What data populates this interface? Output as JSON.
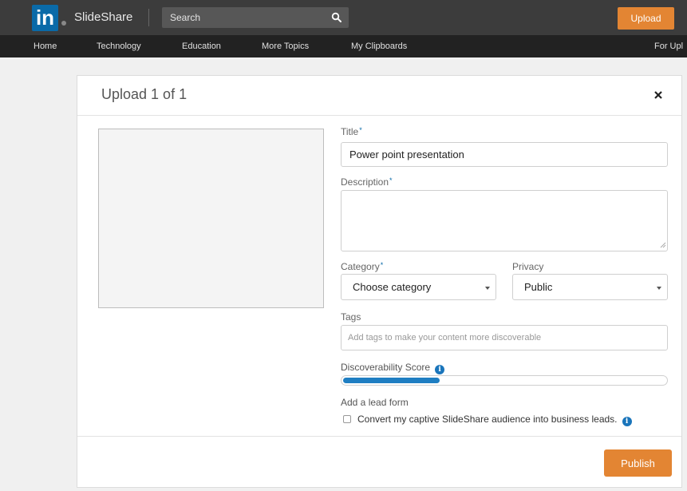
{
  "header": {
    "logo_text": "in",
    "brand": "SlideShare",
    "search_placeholder": "Search",
    "upload_label": "Upload"
  },
  "nav": {
    "items": [
      "Home",
      "Technology",
      "Education",
      "More Topics",
      "My Clipboards",
      "For Upl"
    ]
  },
  "modal": {
    "title": "Upload 1 of 1",
    "title_label": "Title",
    "title_value": "Power point presentation",
    "description_label": "Description",
    "description_value": "",
    "required_marker": "*",
    "category_label": "Category",
    "category_value": "Choose category",
    "privacy_label": "Privacy",
    "privacy_value": "Public",
    "tags_label": "Tags",
    "tags_placeholder": "Add tags to make your content more discoverable",
    "score_label": "Discoverability Score",
    "score_fraction": 0.3,
    "lead_label": "Add a lead form",
    "lead_checkbox_label": "Convert my captive SlideShare audience into business leads.",
    "lead_checked": false,
    "publish_label": "Publish"
  },
  "colors": {
    "accent": "#e38533",
    "brand_blue": "#0a6aa8",
    "score_blue": "#1f7ec2",
    "topbar": "#3c3c3c",
    "nav": "#222222"
  },
  "icons": [
    "search-icon",
    "close-icon",
    "caret-down-icon",
    "info-icon",
    "resize-grip-icon"
  ]
}
